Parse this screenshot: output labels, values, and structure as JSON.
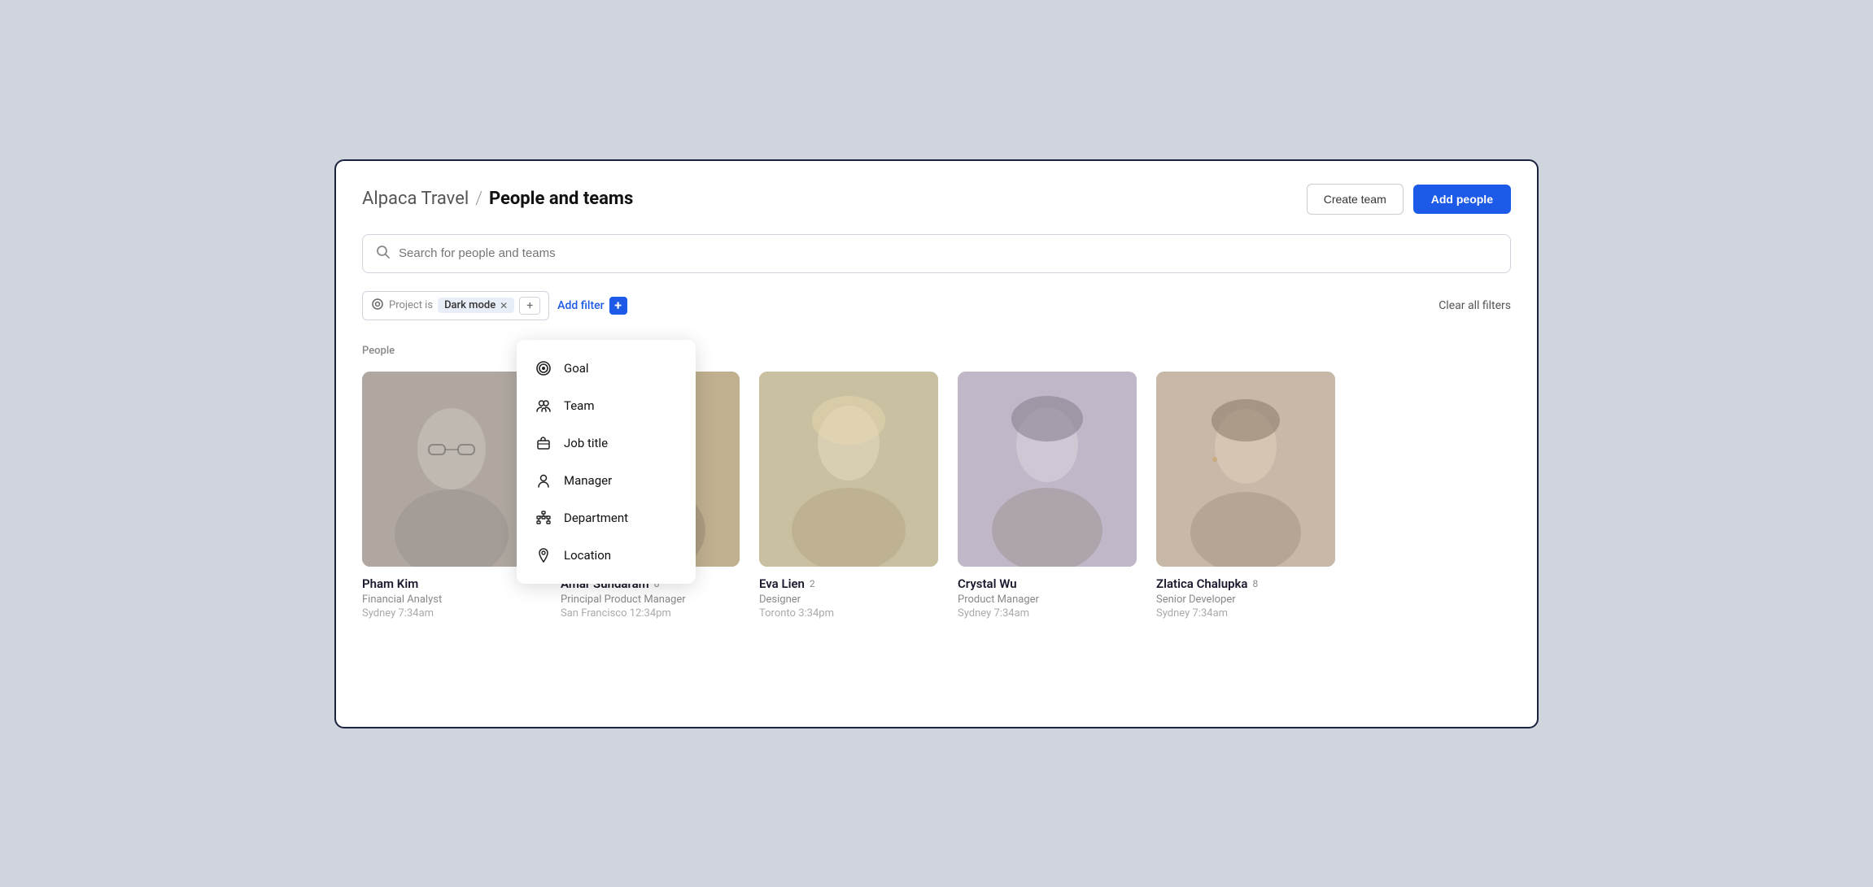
{
  "app": {
    "name": "Alpaca Travel",
    "separator": "/",
    "page_title": "People and teams"
  },
  "header": {
    "create_team_label": "Create team",
    "add_people_label": "Add people"
  },
  "search": {
    "placeholder": "Search for people and teams"
  },
  "filters": {
    "project_label": "Project is",
    "project_value": "Dark mode",
    "add_filter_label": "Add filter",
    "clear_filters_label": "Clear all filters"
  },
  "dropdown": {
    "items": [
      {
        "id": "goal",
        "label": "Goal",
        "icon": "goal"
      },
      {
        "id": "team",
        "label": "Team",
        "icon": "team"
      },
      {
        "id": "job-title",
        "label": "Job title",
        "icon": "job"
      },
      {
        "id": "manager",
        "label": "Manager",
        "icon": "manager"
      },
      {
        "id": "department",
        "label": "Department",
        "icon": "department"
      },
      {
        "id": "location",
        "label": "Location",
        "icon": "location"
      }
    ]
  },
  "section": {
    "label": "People"
  },
  "people": [
    {
      "id": 1,
      "name": "Pham Kim",
      "count": null,
      "role": "Financial Analyst",
      "location": "Sydney",
      "time": "7:34am",
      "photo_class": "photo-1"
    },
    {
      "id": 2,
      "name": "Amar Sundaram",
      "count": "8",
      "role": "Principal Product Manager",
      "location": "San Francisco",
      "time": "12:34pm",
      "photo_class": "photo-2"
    },
    {
      "id": 3,
      "name": "Eva Lien",
      "count": "2",
      "role": "Designer",
      "location": "Toronto",
      "time": "3:34pm",
      "photo_class": "photo-3"
    },
    {
      "id": 4,
      "name": "Crystal Wu",
      "count": null,
      "role": "Product Manager",
      "location": "Sydney",
      "time": "7:34am",
      "photo_class": "photo-4"
    },
    {
      "id": 5,
      "name": "Zlatica Chalupka",
      "count": "8",
      "role": "Senior Developer",
      "location": "Sydney",
      "time": "7:34am",
      "photo_class": "photo-5"
    }
  ]
}
